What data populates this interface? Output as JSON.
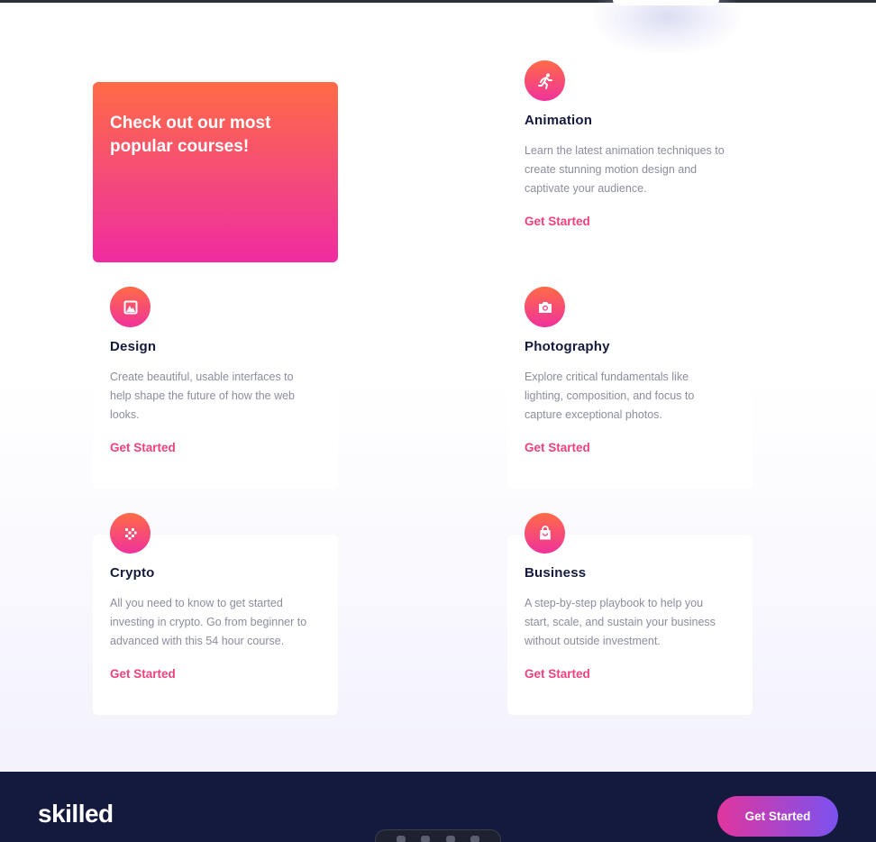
{
  "promo": {
    "title": "Check out our most popular courses!"
  },
  "courses": [
    {
      "title": "Animation",
      "icon": "running-person-icon",
      "description": "Learn the latest animation techniques to create stunning motion design and captivate your audience.",
      "link": "Get Started"
    },
    {
      "title": "Design",
      "icon": "image-icon",
      "description": "Create beautiful, usable interfaces to help shape the future of how the web looks.",
      "link": "Get Started"
    },
    {
      "title": "Photography",
      "icon": "camera-icon",
      "description": "Explore critical fundamentals like lighting, composition, and focus to capture exceptional photos.",
      "link": "Get Started"
    },
    {
      "title": "Crypto",
      "icon": "crypto-icon",
      "description": "All you need to know to get started investing in crypto. Go from beginner to advanced with this 54 hour course.",
      "link": "Get Started"
    },
    {
      "title": "Business",
      "icon": "shopping-bag-icon",
      "description": "A step-by-step playbook to help you start, scale, and sustain your business without outside investment.",
      "link": "Get Started"
    }
  ],
  "footer": {
    "logo": "skilled",
    "cta": "Get Started"
  },
  "colors": {
    "accent": "#f0417a",
    "gradient_start": "#ff6b46",
    "gradient_end": "#f02ba0",
    "heading": "#141a3e",
    "footer_bg": "#141a3e",
    "cta_gradient": [
      "#e0359d",
      "#7b52f0"
    ]
  }
}
